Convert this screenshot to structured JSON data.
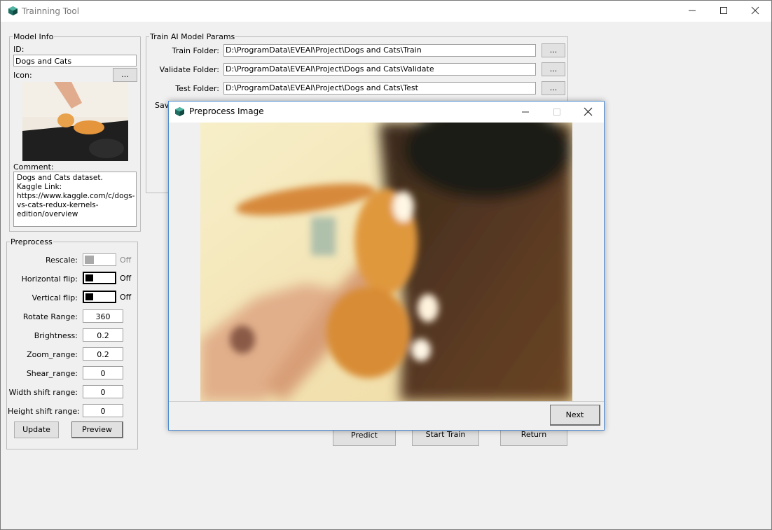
{
  "window": {
    "title": "Trainning Tool"
  },
  "model_info": {
    "legend": "Model Info",
    "id_label": "ID:",
    "id_value": "Dogs and Cats",
    "icon_label": "Icon:",
    "icon_browse": "...",
    "comment_label": "Comment:",
    "comment_value": "Dogs and Cats dataset.\nKaggle Link:\nhttps://www.kaggle.com/c/dogs-\nvs-cats-redux-kernels-\nedition/overview"
  },
  "preprocess": {
    "legend": "Preprocess",
    "rescale_label": "Rescale:",
    "rescale_state": "Off",
    "hflip_label": "Horizontal flip:",
    "hflip_state": "Off",
    "vflip_label": "Vertical flip:",
    "vflip_state": "Off",
    "rotate_label": "Rotate Range:",
    "rotate_value": "360",
    "brightness_label": "Brightness:",
    "brightness_value": "0.2",
    "zoom_label": "Zoom_range:",
    "zoom_value": "0.2",
    "shear_label": "Shear_range:",
    "shear_value": "0",
    "width_label": "Width shift range:",
    "width_value": "0",
    "height_label": "Height shift range:",
    "height_value": "0",
    "update_button": "Update",
    "preview_button": "Preview"
  },
  "train_params": {
    "legend": "Train AI Model Params",
    "train_label": "Train Folder:",
    "train_value": "D:\\ProgramData\\EVEAI\\Project\\Dogs and Cats\\Train",
    "validate_label": "Validate Folder:",
    "validate_value": "D:\\ProgramData\\EVEAI\\Project\\Dogs and Cats\\Validate",
    "test_label": "Test Folder:",
    "test_value": "D:\\ProgramData\\EVEAI\\Project\\Dogs and Cats\\Test",
    "browse": "...",
    "save_label_partial": "Sav"
  },
  "actions": {
    "predict": "Predict",
    "start_train": "Start Train",
    "return": "Return"
  },
  "dialog": {
    "title": "Preprocess Image",
    "next_button": "Next"
  },
  "icons": {
    "app": "cube-icon",
    "minimize": "minimize-icon",
    "maximize": "maximize-icon",
    "close": "close-icon"
  },
  "colors": {
    "app_icon": "#1e6e63",
    "dialog_border": "#4a8bd0"
  }
}
